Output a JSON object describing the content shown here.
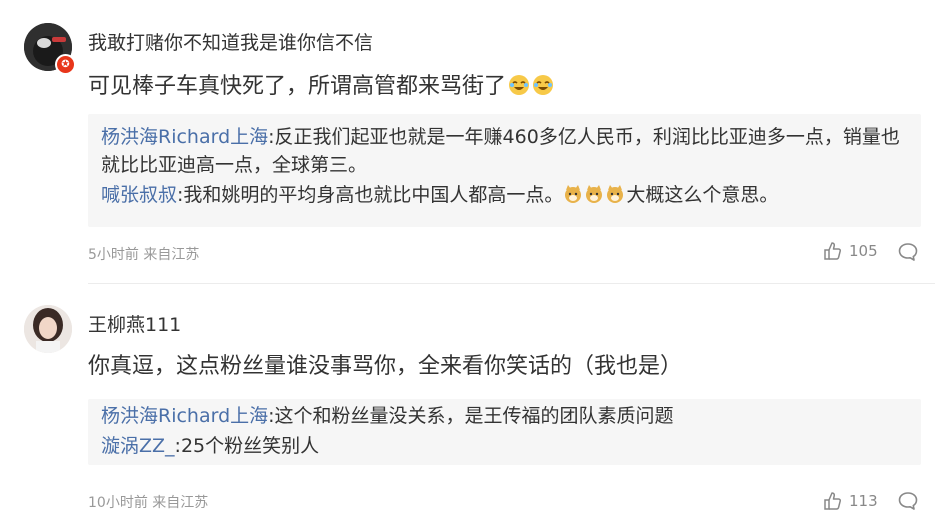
{
  "comments": [
    {
      "username": "我敢打赌你不知道我是谁你信不信",
      "badge": "✪",
      "text": "可见棒子车真快死了，所谓高管都来骂街了",
      "emoji_count": 2,
      "replies": [
        {
          "author": "杨洪海Richard上海",
          "text": ":反正我们起亚也就是一年赚460多亿人民币，利润比比亚迪多一点，销量也就比比亚迪高一点，全球第三。"
        },
        {
          "author": "喊张叔叔",
          "text_after_emoji": "大概这么个意思。",
          "text": ":我和姚明的平均身高也就比中国人都高一点。"
        }
      ],
      "meta": "5小时前 来自江苏",
      "likes": "105"
    },
    {
      "username": "王柳燕111",
      "text": "你真逗，这点粉丝量谁没事骂你，全来看你笑话的（我也是）",
      "replies": [
        {
          "author": "杨洪海Richard上海",
          "text": ":这个和粉丝量没关系，是王传福的团队素质问题"
        },
        {
          "author": "漩涡ZZ_",
          "text": ":25个粉丝笑别人"
        }
      ],
      "meta": "10小时前 来自江苏",
      "likes": "113"
    }
  ],
  "colors": {
    "link": "#4a6fa8",
    "text": "#333333",
    "meta": "#999999",
    "reply_bg": "#f6f6f6"
  }
}
